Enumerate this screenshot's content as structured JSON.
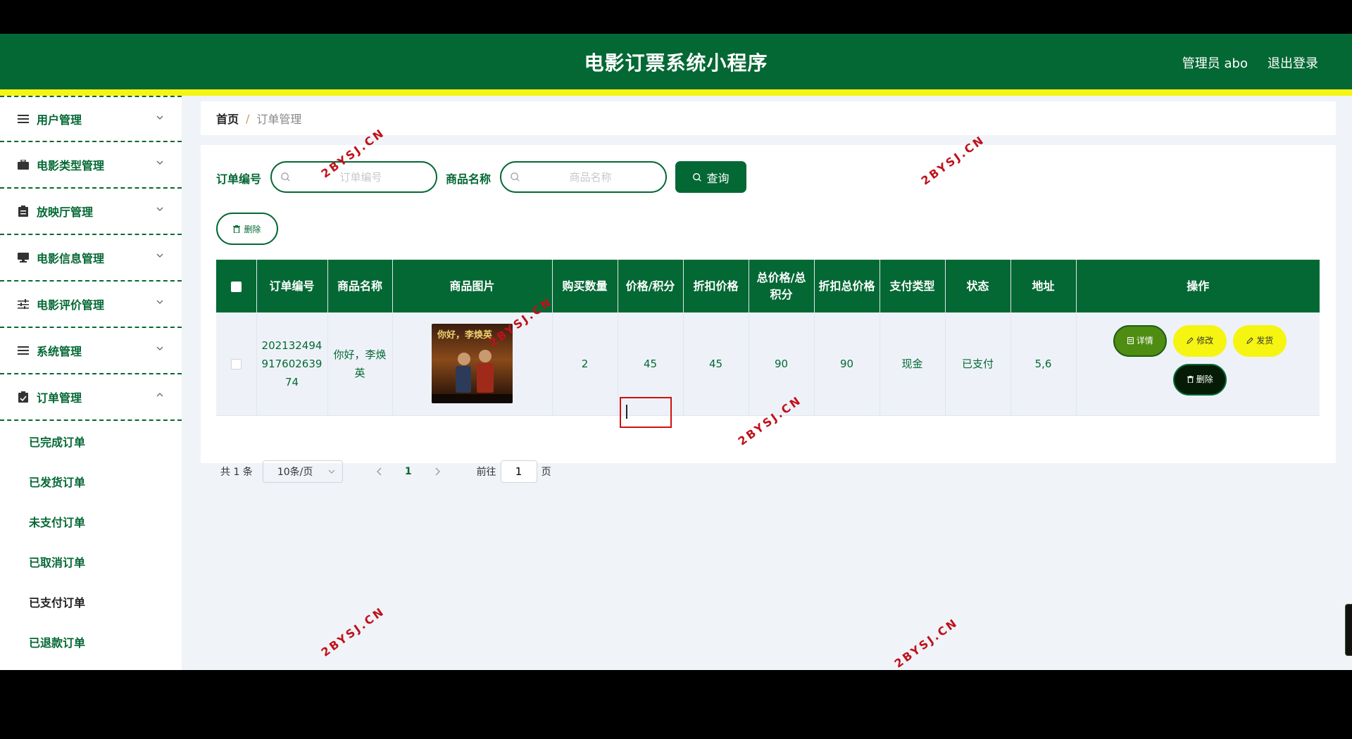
{
  "header": {
    "title": "电影订票系统小程序",
    "admin": "管理员 abo",
    "logout": "退出登录"
  },
  "sidebar": {
    "groups": [
      {
        "label": "用户管理",
        "icon": "list-icon"
      },
      {
        "label": "电影类型管理",
        "icon": "briefcase-icon"
      },
      {
        "label": "放映厅管理",
        "icon": "clipboard-icon"
      },
      {
        "label": "电影信息管理",
        "icon": "monitor-icon"
      },
      {
        "label": "电影评价管理",
        "icon": "sliders-icon"
      },
      {
        "label": "系统管理",
        "icon": "list-icon"
      },
      {
        "label": "订单管理",
        "icon": "clipboard-check-icon"
      }
    ],
    "order_submenu": [
      "已完成订单",
      "已发货订单",
      "未支付订单",
      "已取消订单",
      "已支付订单",
      "已退款订单"
    ],
    "active_submenu": "已支付订单"
  },
  "breadcrumb": {
    "home": "首页",
    "separator": "/",
    "current": "订单管理"
  },
  "search": {
    "order_no_label": "订单编号",
    "order_no_placeholder": "订单编号",
    "product_label": "商品名称",
    "product_placeholder": "商品名称",
    "query_button": "查询"
  },
  "toolbar": {
    "delete_button": "删除"
  },
  "table": {
    "columns": [
      "订单编号",
      "商品名称",
      "商品图片",
      "购买数量",
      "价格/积分",
      "折扣价格",
      "总价格/总积分",
      "折扣总价格",
      "支付类型",
      "状态",
      "地址",
      "操作"
    ],
    "rows": [
      {
        "order_no": "20213249491760263974",
        "product_name": "你好，李焕英",
        "poster_title": "你好，李焕英",
        "quantity": "2",
        "price": "45",
        "discount_price": "45",
        "total_price": "90",
        "discount_total": "90",
        "payment_type": "现金",
        "status": "已支付",
        "address": "5,6"
      }
    ],
    "actions": {
      "detail": "详情",
      "edit": "修改",
      "ship": "发货",
      "delete": "删除"
    }
  },
  "pagination": {
    "total": "共 1 条",
    "page_size": "10条/页",
    "current_page": "1",
    "goto_label": "前往",
    "goto_value": "1",
    "goto_unit": "页"
  },
  "watermark": "2BYSJ.CN",
  "colors": {
    "primary": "#046834",
    "accent_yellow": "#f5f511",
    "detail_green": "#4e8c12",
    "watermark_red": "#c0101a"
  }
}
